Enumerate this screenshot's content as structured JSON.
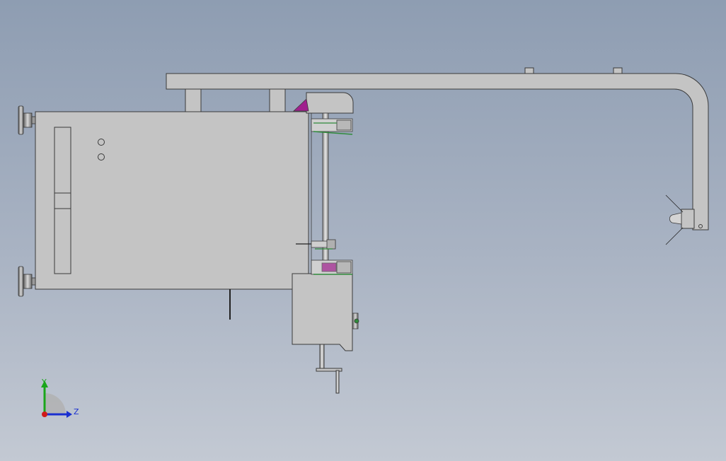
{
  "viewport": {
    "background_top": "#8e9db2",
    "background_bottom": "#c3c9d3"
  },
  "model": {
    "body_color": "#c4c4c4",
    "edge_color": "#3a3a3a",
    "accent_magenta": "#a0208e",
    "accent_green": "#2f8a3a"
  },
  "triad": {
    "y_label": "Y",
    "z_label": "Z",
    "y_color": "#1aa61a",
    "z_color": "#1a2fd0",
    "x_color": "#d01a1a"
  }
}
